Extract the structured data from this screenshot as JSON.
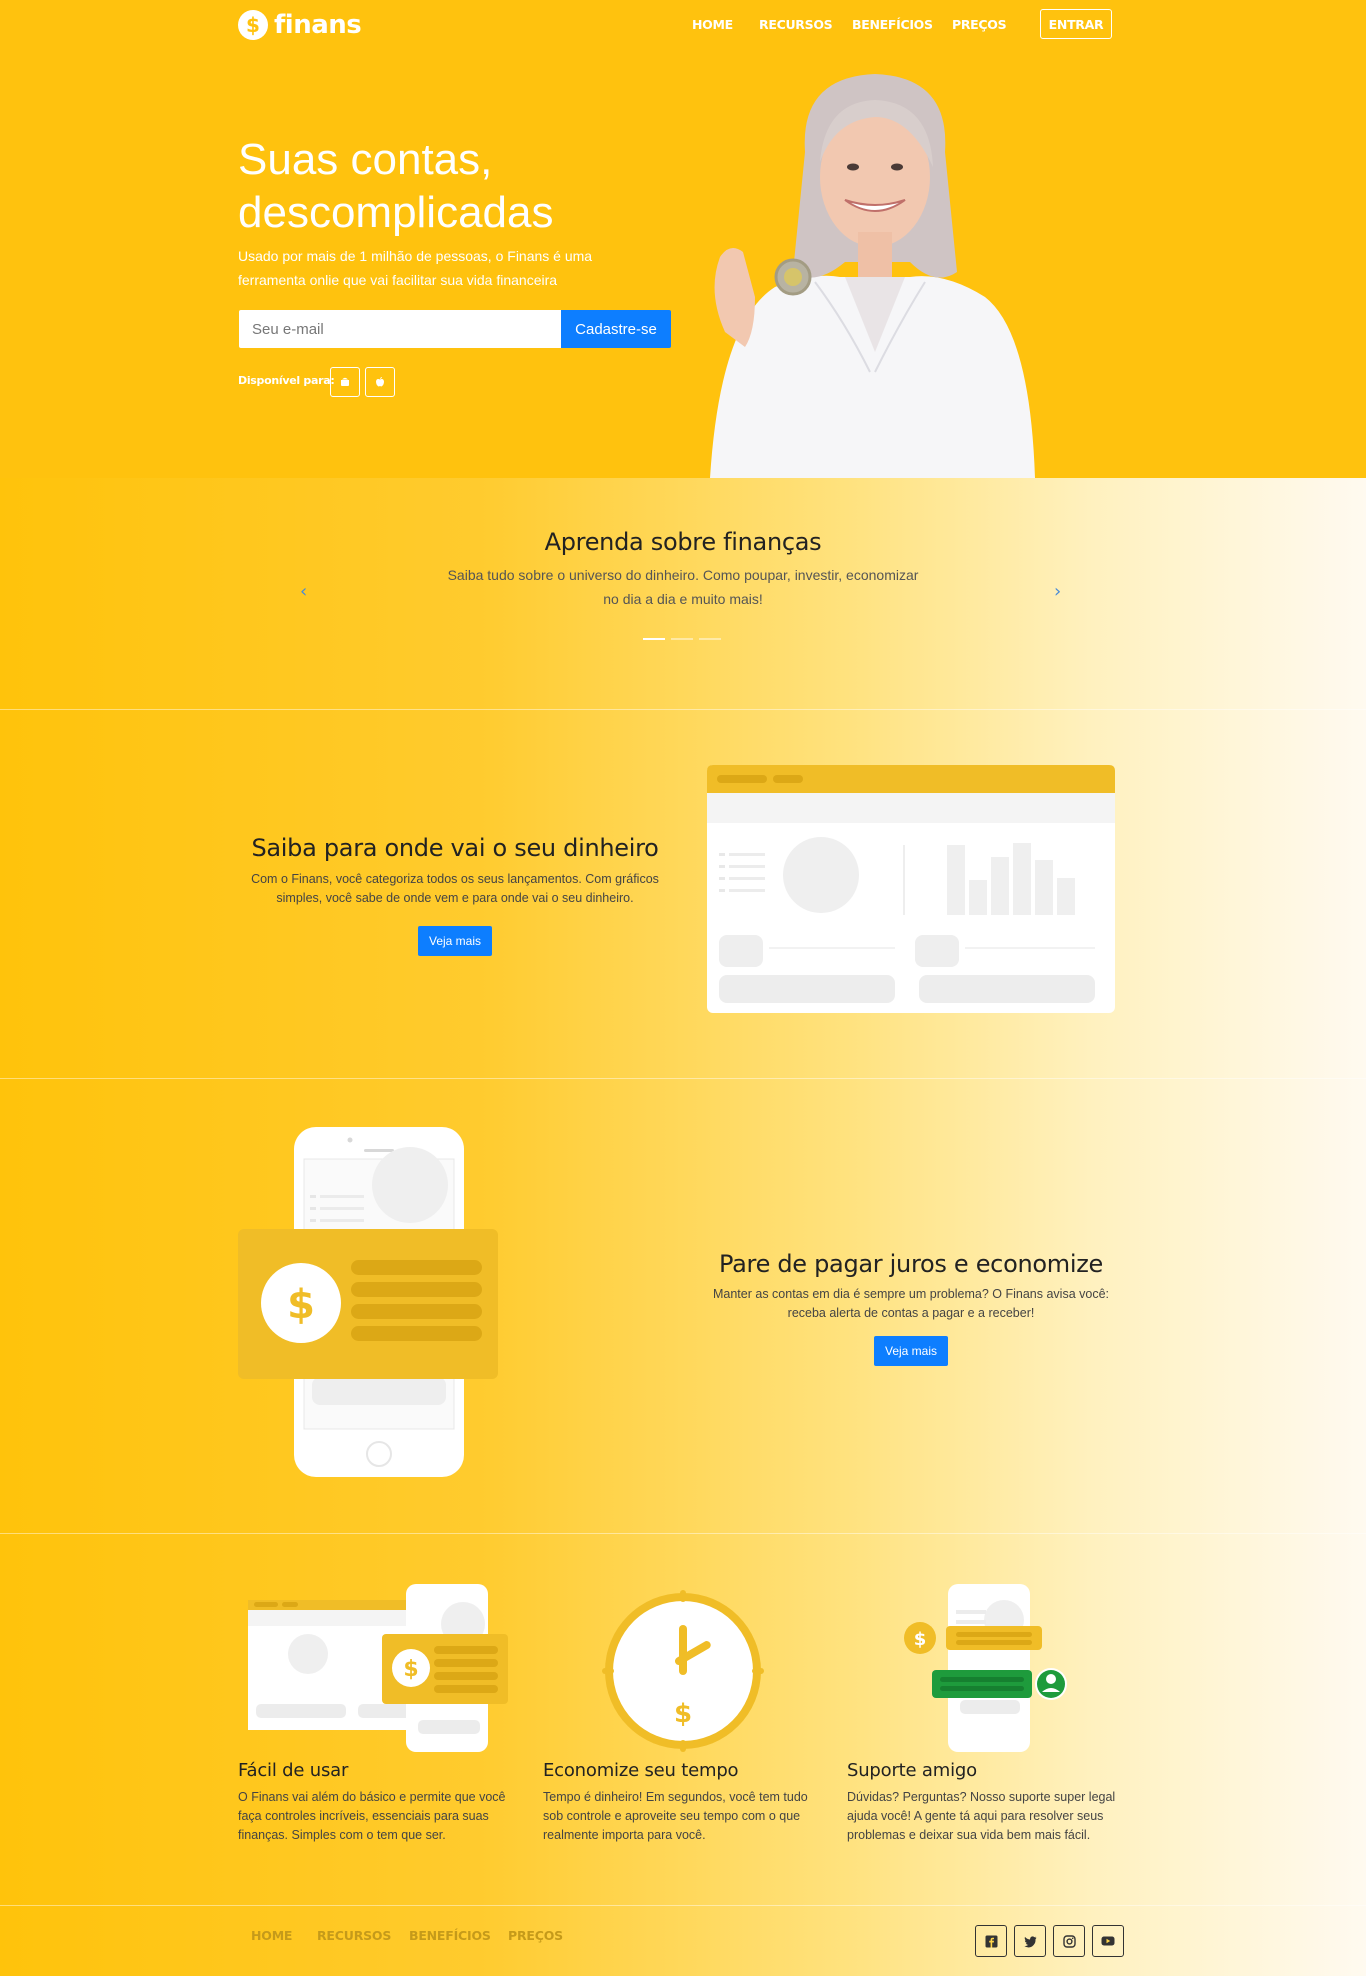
{
  "brand": {
    "logo_symbol": "$",
    "name": "finans"
  },
  "nav": {
    "home": "HOME",
    "recursos": "RECURSOS",
    "beneficios": "BENEFÍCIOS",
    "precos": "PREÇOS",
    "entrar": "ENTRAR"
  },
  "hero": {
    "title_line1": "Suas contas,",
    "title_line2": "descomplicadas",
    "subtitle": "Usado por mais de 1 milhão de pessoas, o Finans é uma ferramenta onlie que vai facilitar sua vida financeira",
    "email_placeholder": "Seu e-mail",
    "signup_button": "Cadastre-se",
    "available_label": "Disponível para:",
    "store_icons": [
      "android-icon",
      "apple-icon"
    ]
  },
  "learn": {
    "title": "Aprenda sobre finanças",
    "text": "Saiba tudo sobre o universo do dinheiro. Como poupar, investir, economizar no dia a dia e muito mais!",
    "prev": "‹",
    "next": "›",
    "active_slide": 1,
    "slide_count": 3
  },
  "feature1": {
    "title": "Saiba para onde vai o seu dinheiro",
    "text": "Com o Finans, você categoriza todos os seus lançamentos. Com gráficos simples, você sabe de onde vem e para onde vai o seu dinheiro.",
    "button": "Veja mais"
  },
  "feature2": {
    "title": "Pare de pagar juros e economize",
    "text": "Manter as contas em dia é sempre um problema? O Finans avisa você: receba alerta de contas a pagar e a receber!",
    "button": "Veja mais",
    "card_symbol": "$"
  },
  "benefits": [
    {
      "title": "Fácil de usar",
      "text": "O Finans vai além do básico e permite que você faça controles incríveis, essenciais para suas finanças. Simples com o tem que ser.",
      "symbol": "$"
    },
    {
      "title": "Economize seu tempo",
      "text": "Tempo é dinheiro! Em segundos, você tem tudo sob controle e aproveite seu tempo com o que realmente importa para você.",
      "symbol": "$"
    },
    {
      "title": "Suporte amigo",
      "text": "Dúvidas? Perguntas? Nosso suporte super legal ajuda você! A gente tá aqui para resolver seus problemas e deixar sua vida bem mais fácil.",
      "symbol": "$"
    }
  ],
  "footer": {
    "nav": {
      "home": "HOME",
      "recursos": "RECURSOS",
      "beneficios": "BENEFÍCIOS",
      "precos": "PREÇOS"
    },
    "social_icons": [
      "facebook-icon",
      "twitter-icon",
      "instagram-icon",
      "youtube-icon"
    ]
  },
  "colors": {
    "brand_yellow": "#ffc20e",
    "accent_blue": "#0d7eff",
    "card_yellow": "#f0bd27",
    "green": "#1e9b3c"
  }
}
